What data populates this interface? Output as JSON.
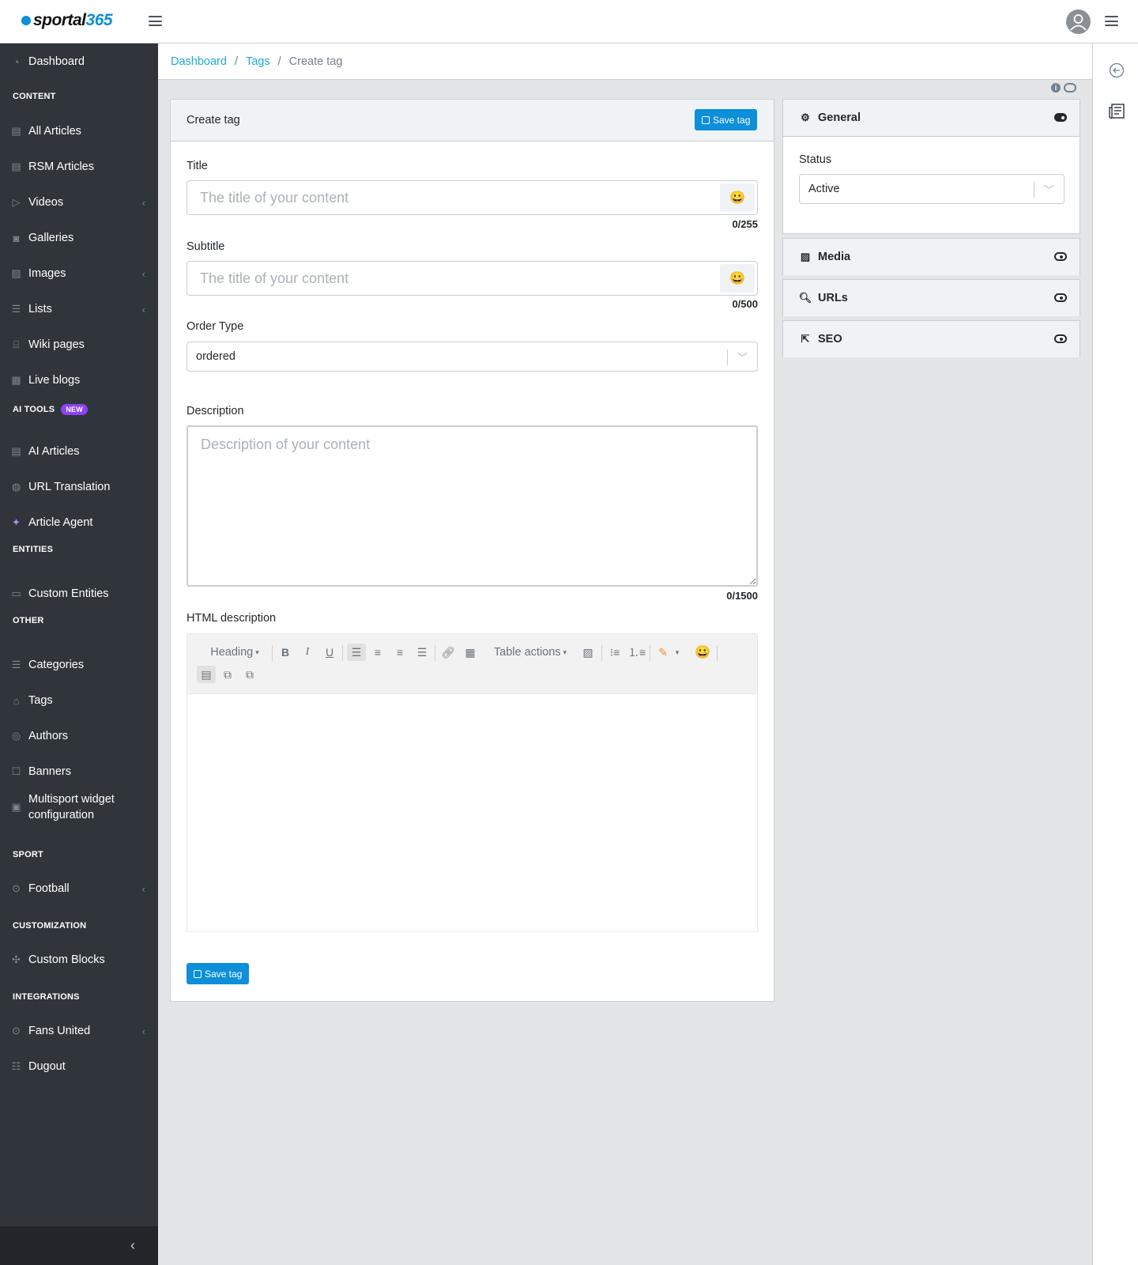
{
  "brand": {
    "logo_part1": "sportal",
    "logo_part2": "365"
  },
  "sidebar": {
    "items": [
      {
        "label": "Dashboard",
        "icon": "dashboard-icon"
      },
      {
        "label": "CONTENT",
        "section": true
      },
      {
        "label": "All Articles",
        "icon": "document-icon"
      },
      {
        "label": "RSM Articles",
        "icon": "document-icon"
      },
      {
        "label": "Videos",
        "icon": "play-icon",
        "expandable": true
      },
      {
        "label": "Galleries",
        "icon": "camera-icon"
      },
      {
        "label": "Images",
        "icon": "image-icon",
        "expandable": true
      },
      {
        "label": "Lists",
        "icon": "list-icon",
        "expandable": true
      },
      {
        "label": "Wiki pages",
        "icon": "book-icon"
      },
      {
        "label": "Live blogs",
        "icon": "newspaper-icon"
      },
      {
        "label": "AI TOOLS",
        "section": true,
        "badge": "NEW"
      },
      {
        "label": "AI Articles",
        "icon": "document-icon"
      },
      {
        "label": "URL Translation",
        "icon": "globe-icon"
      },
      {
        "label": "Article Agent",
        "icon": "sparkle-icon"
      },
      {
        "label": "ENTITIES",
        "section": true
      },
      {
        "label": "Custom Entities",
        "icon": "monitor-icon"
      },
      {
        "label": "OTHER",
        "section": true
      },
      {
        "label": "Categories",
        "icon": "list-icon"
      },
      {
        "label": "Tags",
        "icon": "tag-icon"
      },
      {
        "label": "Authors",
        "icon": "user-circle-icon"
      },
      {
        "label": "Banners",
        "icon": "square-icon"
      },
      {
        "label": "Multisport widget configuration",
        "icon": "calendar-icon"
      },
      {
        "label": "SPORT",
        "section": true
      },
      {
        "label": "Football",
        "icon": "ball-icon",
        "expandable": true
      },
      {
        "label": "CUSTOMIZATION",
        "section": true
      },
      {
        "label": "Custom Blocks",
        "icon": "puzzle-icon"
      },
      {
        "label": "INTEGRATIONS",
        "section": true
      },
      {
        "label": "Fans United",
        "icon": "ball-icon",
        "expandable": true
      },
      {
        "label": "Dugout",
        "icon": "server-icon"
      }
    ]
  },
  "breadcrumb": {
    "dashboard": "Dashboard",
    "tags": "Tags",
    "current": "Create tag"
  },
  "form": {
    "card_title": "Create tag",
    "save_label": "Save tag",
    "title_label": "Title",
    "title_placeholder": "The title of your content",
    "title_counter": "0/255",
    "subtitle_label": "Subtitle",
    "subtitle_placeholder": "The title of your content",
    "subtitle_counter": "0/500",
    "order_type_label": "Order Type",
    "order_type_value": "ordered",
    "description_label": "Description",
    "description_placeholder": "Description of your content",
    "description_counter": "0/1500",
    "html_description_label": "HTML description",
    "editor": {
      "heading_label": "Heading",
      "table_actions_label": "Table actions"
    }
  },
  "panels": {
    "general": {
      "title": "General",
      "status_label": "Status",
      "status_value": "Active"
    },
    "media": {
      "title": "Media"
    },
    "urls": {
      "title": "URLs"
    },
    "seo": {
      "title": "SEO"
    }
  },
  "colors": {
    "accent": "#0d8fd9",
    "sidebar_bg": "#2f353a",
    "link": "#20a8d8",
    "badge": "#8d42f5"
  }
}
